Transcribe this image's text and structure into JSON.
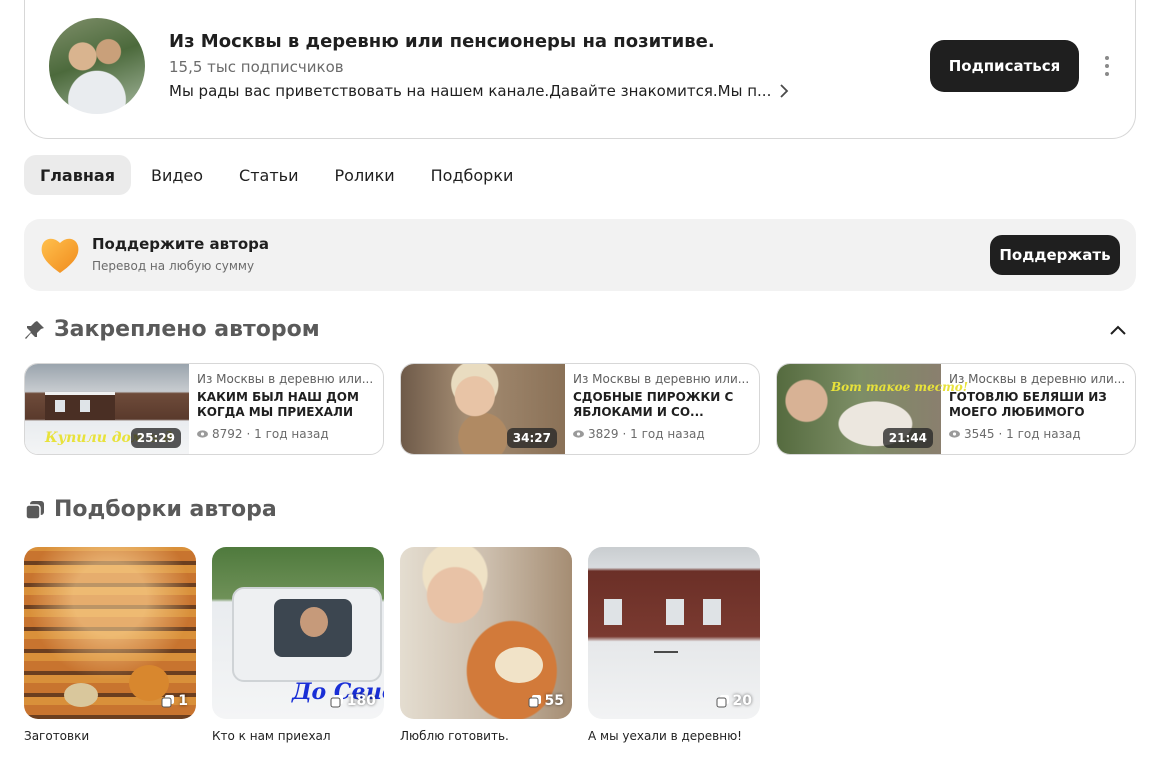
{
  "channel": {
    "title": "Из Москвы в деревню или пенсионеры на позитиве.",
    "subscribers": "15,5 тыс подписчиков",
    "description": "Мы рады вас приветствовать на нашем канале.Давайте знакомится.Мы п...",
    "subscribe_label": "Подписаться"
  },
  "tabs": [
    {
      "label": "Главная",
      "active": true
    },
    {
      "label": "Видео"
    },
    {
      "label": "Статьи"
    },
    {
      "label": "Ролики"
    },
    {
      "label": "Подборки"
    }
  ],
  "support": {
    "title": "Поддержите автора",
    "subtitle": "Перевод на любую сумму",
    "button_label": "Поддержать"
  },
  "pinned": {
    "title": "Закреплено автором",
    "items": [
      {
        "channel": "Из Москвы в деревню или...",
        "title": "КАКИМ БЫЛ НАШ ДОМ КОГДА МЫ ПРИЕХАЛИ В...",
        "duration": "25:29",
        "views": "8792",
        "age": "· 1 год назад",
        "overlay": "Купили дом в д"
      },
      {
        "channel": "Из Москвы в деревню или...",
        "title": "СДОБНЫЕ ПИРОЖКИ С ЯБЛОКАМИ И СО...",
        "duration": "34:27",
        "views": "3829",
        "age": "· 1 год назад",
        "overlay": ""
      },
      {
        "channel": "Из Москвы в деревню или...",
        "title": "ГОТОВЛЮ БЕЛЯШИ ИЗ МОЕГО ЛЮБИМОГО ТЕСТА.",
        "duration": "21:44",
        "views": "3545",
        "age": "· 1 год назад",
        "overlay": "Вот такое тесто!"
      }
    ]
  },
  "playlists": {
    "title": "Подборки автора",
    "items": [
      {
        "name": "Заготовки",
        "count": "1"
      },
      {
        "name": "Кто к нам приехал",
        "count": "180",
        "overlay": "До Свид"
      },
      {
        "name": "Люблю готовить.",
        "count": "55"
      },
      {
        "name": "А мы уехали в деревню!",
        "count": "20"
      }
    ]
  },
  "colors": {
    "primary_button": "#1f1f1f",
    "banner_bg": "#f2f2f2",
    "heart": "#f5a623"
  }
}
